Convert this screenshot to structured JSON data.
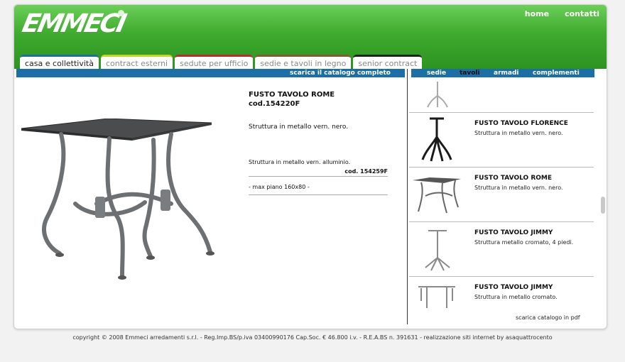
{
  "header": {
    "logo_text": "EMMECI",
    "nav": [
      {
        "label": "home"
      },
      {
        "label": "contatti"
      }
    ]
  },
  "tabs": [
    {
      "label": "casa e collettività",
      "active": true
    },
    {
      "label": "contract esterni"
    },
    {
      "label": "sedute per ufficio"
    },
    {
      "label": "sedie e tavoli in legno"
    },
    {
      "label": "senior contract"
    }
  ],
  "catalog_link": "scarica il catalogo completo",
  "subnav": [
    {
      "label": "sedie"
    },
    {
      "label": "tavoli",
      "active": true
    },
    {
      "label": "armadi"
    },
    {
      "label": "complementi"
    }
  ],
  "product": {
    "title": "FUSTO TAVOLO ROME",
    "code": "cod.154220F",
    "description": "Struttura in metallo vern. nero.",
    "variant_description": "Struttura in metallo vern. alluminio.",
    "variant_code": "cod. 154259F",
    "note": "- max piano 160x80 -"
  },
  "list": [
    {
      "name": "FUSTO TAVOLO FLORENCE",
      "sub": "Struttura in metallo vern. nero."
    },
    {
      "name": "FUSTO TAVOLO ROME",
      "sub": "Struttura in metallo vern. nero."
    },
    {
      "name": "FUSTO TAVOLO JIMMY",
      "sub": "Struttura metallo cromato, 4 piedi."
    },
    {
      "name": "FUSTO TAVOLO JIMMY",
      "sub": "Struttura in metallo cromato."
    }
  ],
  "pdf_link": "scarica catalogo in pdf",
  "footer": "copyright © 2008 Emmeci arredamenti s.r.l. - Reg.Imp.BS/p.iva 03400990176 Cap.Soc. € 46.800 i.v. - R.E.A.BS n. 391631 - realizzazione siti internet by asaquattrocento",
  "colors": {
    "header_green": "#3eaa2e",
    "bar_blue": "#1c6fa6"
  }
}
